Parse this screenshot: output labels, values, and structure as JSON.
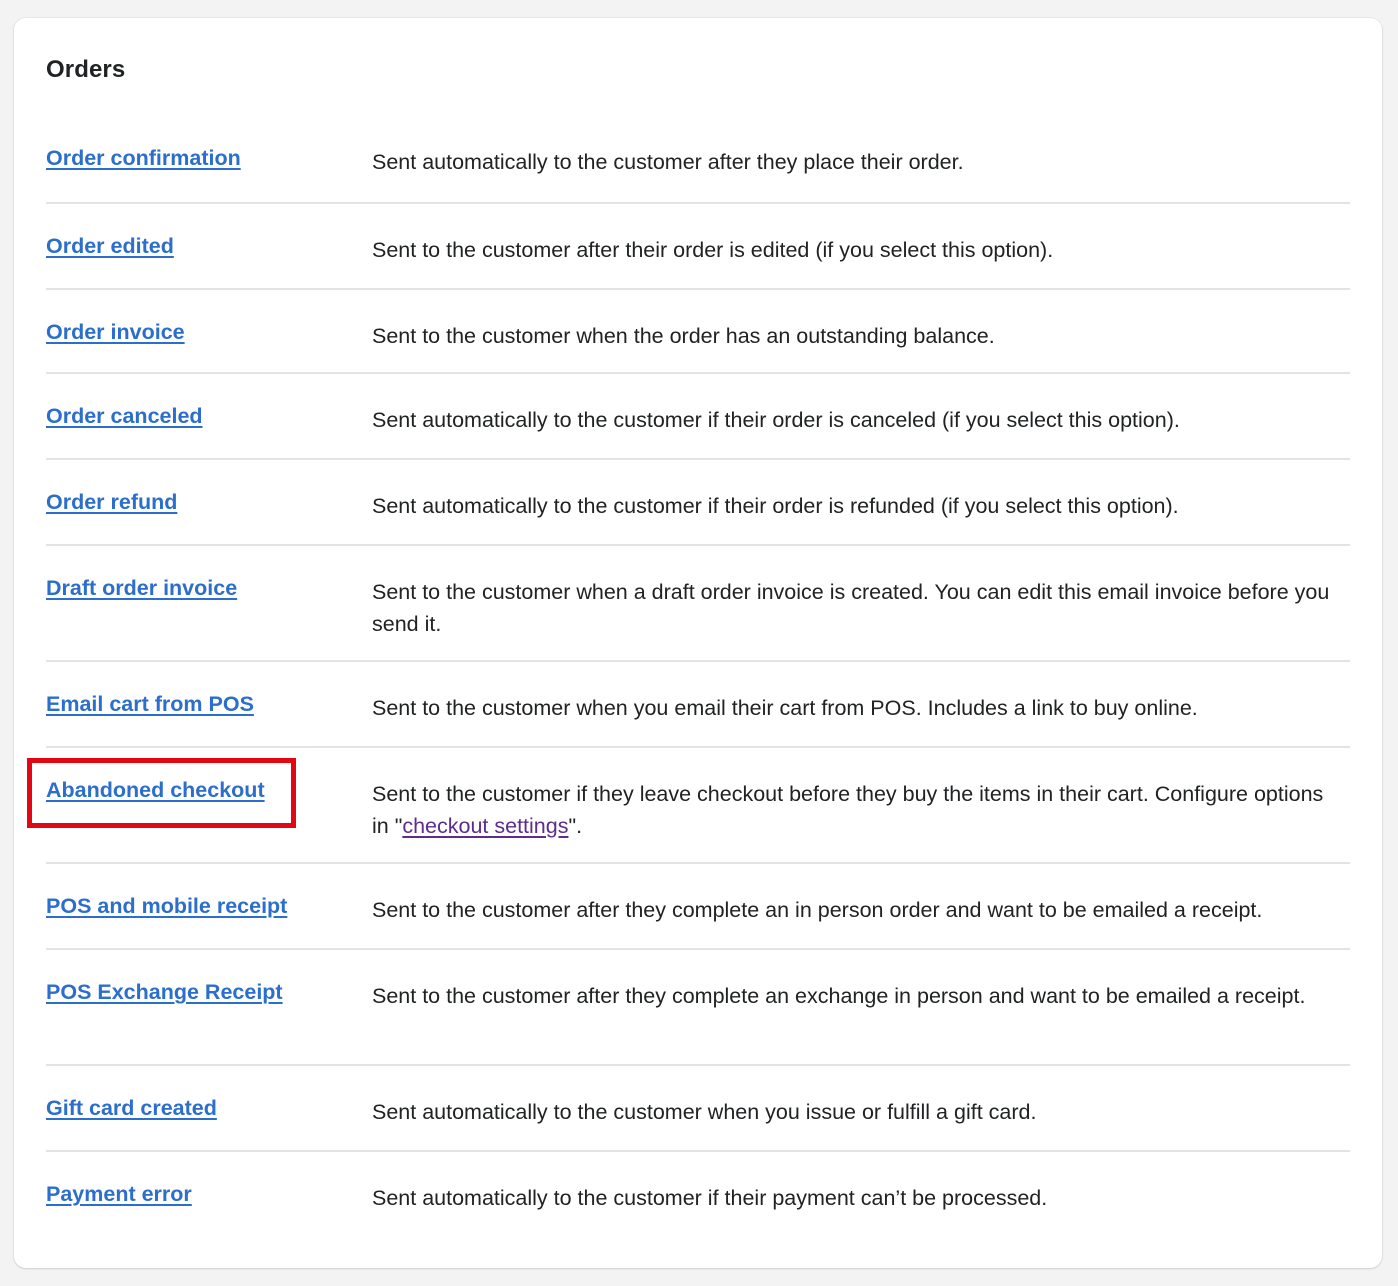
{
  "section": {
    "title": "Orders"
  },
  "rows": [
    {
      "link": "Order confirmation",
      "desc": "Sent automatically to the customer after they place their order."
    },
    {
      "link": "Order edited",
      "desc": "Sent to the customer after their order is edited (if you select this option)."
    },
    {
      "link": "Order invoice",
      "desc": "Sent to the customer when the order has an outstanding balance."
    },
    {
      "link": "Order canceled",
      "desc": "Sent automatically to the customer if their order is canceled (if you select this option)."
    },
    {
      "link": "Order refund",
      "desc": "Sent automatically to the customer if their order is refunded (if you select this option)."
    },
    {
      "link": "Draft order invoice",
      "desc": "Sent to the customer when a draft order invoice is created. You can edit this email invoice before you send it."
    },
    {
      "link": "Email cart from POS",
      "desc": "Sent to the customer when you email their cart from POS. Includes a link to buy online."
    },
    {
      "link": "Abandoned checkout",
      "desc_before": "Sent to the customer if they leave checkout before they buy the items in their cart. Configure options in \"",
      "desc_link": "checkout settings",
      "desc_after": "\"."
    },
    {
      "link": "POS and mobile receipt",
      "desc": "Sent to the customer after they complete an in person order and want to be emailed a receipt."
    },
    {
      "link": "POS Exchange Receipt",
      "desc": "Sent to the customer after they complete an exchange in person and want to be emailed a receipt."
    },
    {
      "link": "Gift card created",
      "desc": "Sent automatically to the customer when you issue or fulfill a gift card."
    },
    {
      "link": "Payment error",
      "desc": "Sent automatically to the customer if their payment can’t be processed."
    }
  ],
  "colors": {
    "link": "#2c6ecb",
    "visited_link": "#5c2d91",
    "highlight": "#e30613",
    "divider": "#e3e3e3"
  }
}
